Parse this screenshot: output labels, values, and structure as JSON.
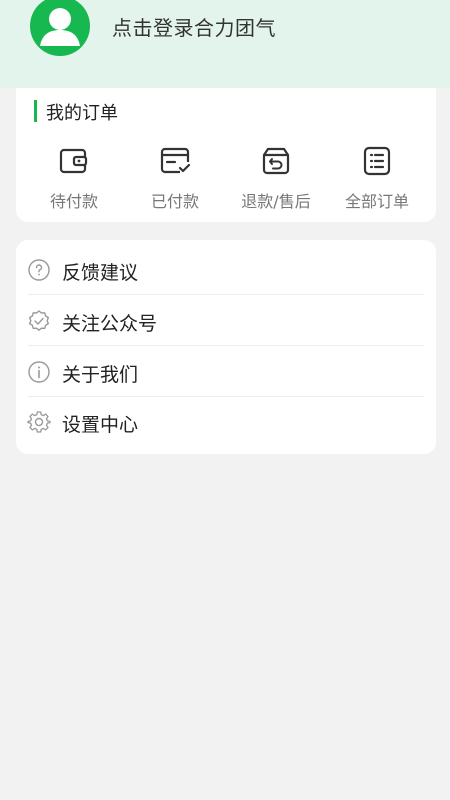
{
  "header": {
    "login_text": "点击登录合力团气",
    "avatar_color": "#16b84f",
    "background_color": "#e2f4ec"
  },
  "orders": {
    "title": "我的订单",
    "accent_color": "#16b84f",
    "items": [
      {
        "label": "待付款",
        "icon": "wallet-icon"
      },
      {
        "label": "已付款",
        "icon": "paid-card-icon"
      },
      {
        "label": "退款/售后",
        "icon": "refund-box-icon"
      },
      {
        "label": "全部订单",
        "icon": "order-list-icon"
      }
    ]
  },
  "menu": {
    "items": [
      {
        "label": "反馈建议",
        "icon": "question-circle-icon"
      },
      {
        "label": "关注公众号",
        "icon": "verified-badge-icon"
      },
      {
        "label": "关于我们",
        "icon": "info-circle-icon"
      },
      {
        "label": "设置中心",
        "icon": "gear-icon"
      }
    ]
  }
}
